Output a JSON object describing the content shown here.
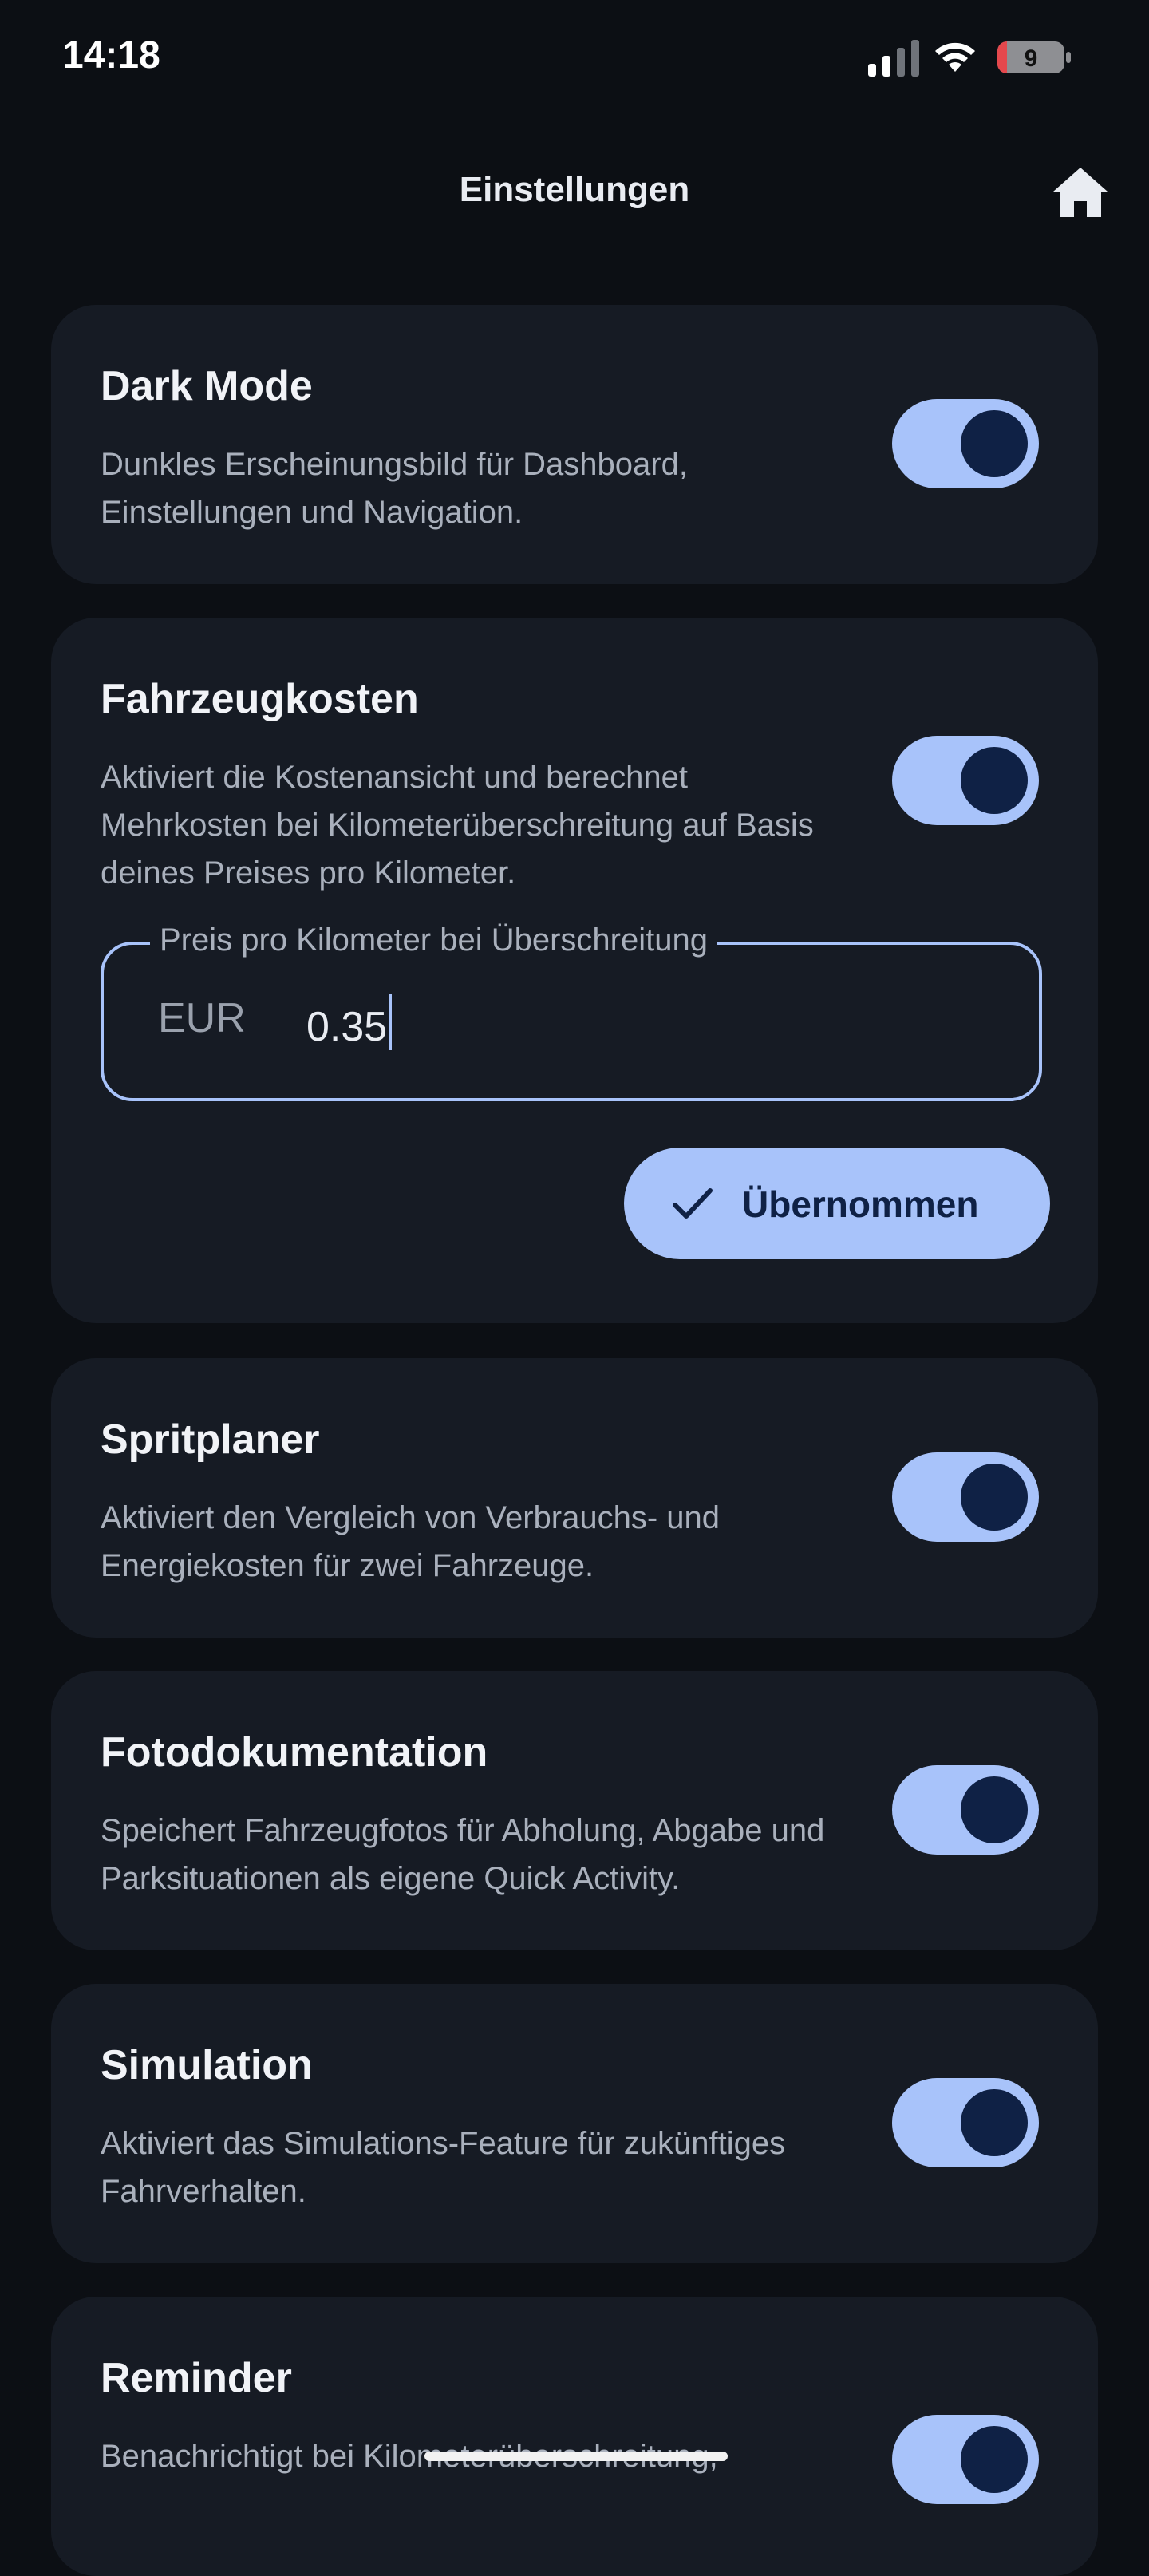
{
  "status_bar": {
    "time": "14:18",
    "battery": "9"
  },
  "header": {
    "title": "Einstellungen",
    "home_icon": "home-icon"
  },
  "settings": {
    "dark_mode": {
      "title": "Dark Mode",
      "description": "Dunkles Erscheinungsbild für Dashboard, Einstellungen und Navigation.",
      "enabled": true
    },
    "vehicle_costs": {
      "title": "Fahrzeugkosten",
      "description": "Aktiviert die Kostenansicht und berechnet Mehrkosten bei Kilometerüberschreitung auf Basis deines Preises pro Kilometer.",
      "enabled": true,
      "price_field": {
        "label": "Preis pro Kilometer bei Überschreitung",
        "prefix": "EUR",
        "value": "0.35"
      },
      "accept_button": {
        "label": "Übernommen",
        "icon": "check-icon"
      }
    },
    "fuel_planner": {
      "title": "Spritplaner",
      "description": "Aktiviert den Vergleich von Verbrauchs- und Energiekosten für zwei Fahrzeuge.",
      "enabled": true
    },
    "photo_docs": {
      "title": "Fotodokumentation",
      "description": "Speichert Fahrzeugfotos für Abholung, Abgabe und Parksituationen als eigene Quick Activity.",
      "enabled": true
    },
    "simulation": {
      "title": "Simulation",
      "description": "Aktiviert das Simulations-Feature für zukünftiges Fahrverhalten.",
      "enabled": true
    },
    "reminder": {
      "title": "Reminder",
      "description": "Benachrichtigt bei Kilometerüberschreitung,",
      "enabled": true
    }
  },
  "colors": {
    "background": "#0c0f14",
    "card": "#161b24",
    "accent": "#a8c3fa",
    "accent_dark": "#0f2145",
    "text_secondary": "#a9b0bc"
  }
}
